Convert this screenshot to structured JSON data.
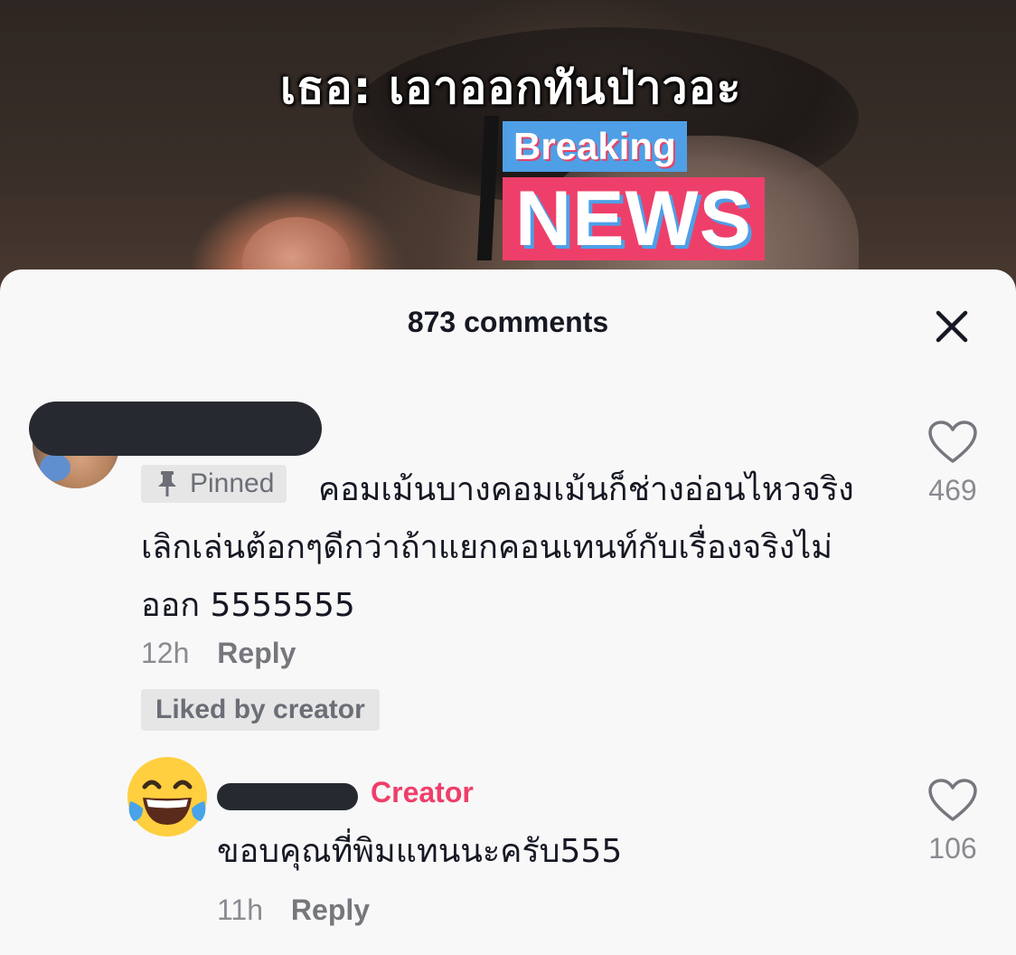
{
  "video": {
    "caption": "เธอ: เอาออกทันป่าวอะ",
    "badge_top": "Breaking",
    "badge_bottom": "NEWS"
  },
  "comments_sheet": {
    "title": "873 comments",
    "close_icon": "close-icon"
  },
  "comments": [
    {
      "pinned_label": "Pinned",
      "text": "คอมเม้นบางคอมเม้นก็ช่างอ่อนไหวจริงเลิกเล่นต้อกๆดีกว่าถ้าแยกคอนเทนท์กับเรื่องจริงไม่ออก 5555555",
      "time": "12h",
      "reply_label": "Reply",
      "liked_label": "Liked by creator",
      "likes": "469",
      "replies": [
        {
          "creator_label": "Creator",
          "avatar_icon": "laughing-emoji-icon",
          "text": "ขอบคุณที่พิมแทนนะครับ555",
          "time": "11h",
          "reply_label": "Reply",
          "likes": "106"
        }
      ]
    }
  ],
  "colors": {
    "creator_accent": "#ee3f6a",
    "breaking_blue": "#4f9fe6",
    "news_pink": "#ee3f6a",
    "sheet_bg": "#f8f8f8"
  }
}
